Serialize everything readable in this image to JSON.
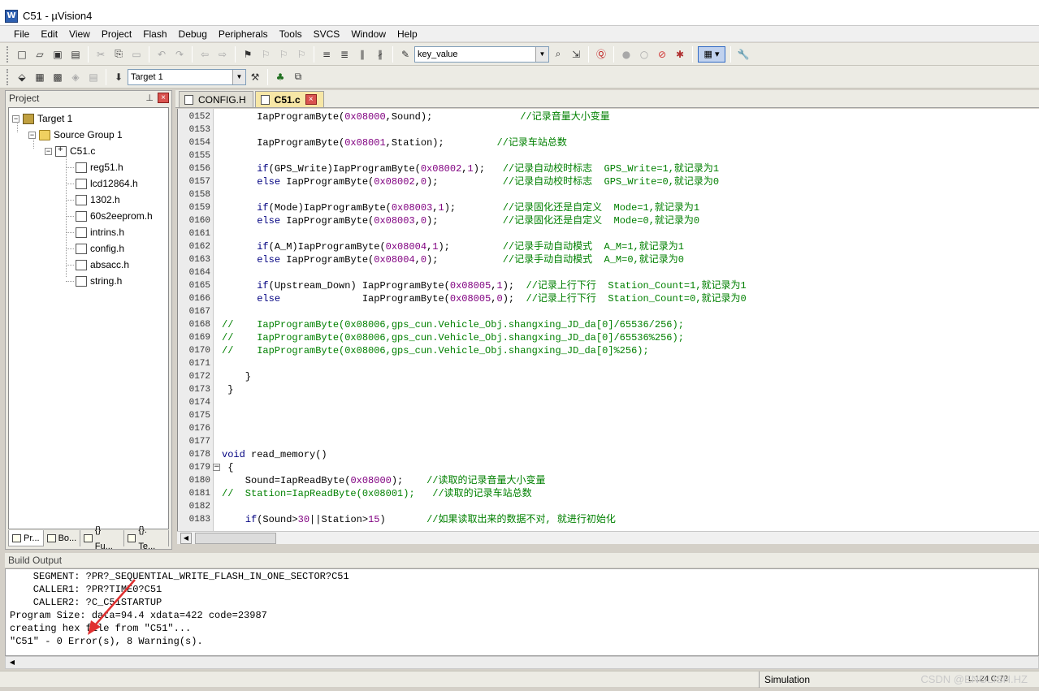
{
  "window": {
    "title": "C51  - µVision4",
    "icon_letter": "W"
  },
  "menu": [
    "File",
    "Edit",
    "View",
    "Project",
    "Flash",
    "Debug",
    "Peripherals",
    "Tools",
    "SVCS",
    "Window",
    "Help"
  ],
  "toolbar": {
    "find_value": "key_value",
    "target_value": "Target 1"
  },
  "project_panel": {
    "title": "Project",
    "tree": {
      "target": "Target 1",
      "group": "Source Group 1",
      "file": "C51.c",
      "includes": [
        "reg51.h",
        "lcd12864.h",
        "1302.h",
        "60s2eeprom.h",
        "intrins.h",
        "config.h",
        "absacc.h",
        "string.h"
      ]
    },
    "tabs": [
      "Pr...",
      "Bo...",
      "{} Fu...",
      "{}. Te..."
    ]
  },
  "editor_tabs": [
    {
      "label": "CONFIG.H",
      "active": false
    },
    {
      "label": "C51.c",
      "active": true
    }
  ],
  "code_lines": [
    {
      "n": "0152",
      "code": "      IapProgramByte(0x08000,Sound);               //记录音量大小变量"
    },
    {
      "n": "0153",
      "code": ""
    },
    {
      "n": "0154",
      "code": "      IapProgramByte(0x08001,Station);         //记录车站总数"
    },
    {
      "n": "0155",
      "code": ""
    },
    {
      "n": "0156",
      "code": "      if(GPS_Write)IapProgramByte(0x08002,1);   //记录自动校时标志  GPS_Write=1,就记录为1"
    },
    {
      "n": "0157",
      "code": "      else IapProgramByte(0x08002,0);           //记录自动校时标志  GPS_Write=0,就记录为0"
    },
    {
      "n": "0158",
      "code": ""
    },
    {
      "n": "0159",
      "code": "      if(Mode)IapProgramByte(0x08003,1);        //记录固化还是自定义  Mode=1,就记录为1"
    },
    {
      "n": "0160",
      "code": "      else IapProgramByte(0x08003,0);           //记录固化还是自定义  Mode=0,就记录为0"
    },
    {
      "n": "0161",
      "code": ""
    },
    {
      "n": "0162",
      "code": "      if(A_M)IapProgramByte(0x08004,1);         //记录手动自动模式  A_M=1,就记录为1"
    },
    {
      "n": "0163",
      "code": "      else IapProgramByte(0x08004,0);           //记录手动自动模式  A_M=0,就记录为0"
    },
    {
      "n": "0164",
      "code": ""
    },
    {
      "n": "0165",
      "code": "      if(Upstream_Down) IapProgramByte(0x08005,1);  //记录上行下行  Station_Count=1,就记录为1"
    },
    {
      "n": "0166",
      "code": "      else              IapProgramByte(0x08005,0);  //记录上行下行  Station_Count=0,就记录为0"
    },
    {
      "n": "0167",
      "code": ""
    },
    {
      "n": "0168",
      "code": "//    IapProgramByte(0x08006,gps_cun.Vehicle_Obj.shangxing_JD_da[0]/65536/256);"
    },
    {
      "n": "0169",
      "code": "//    IapProgramByte(0x08006,gps_cun.Vehicle_Obj.shangxing_JD_da[0]/65536%256);"
    },
    {
      "n": "0170",
      "code": "//    IapProgramByte(0x08006,gps_cun.Vehicle_Obj.shangxing_JD_da[0]%256);"
    },
    {
      "n": "0171",
      "code": ""
    },
    {
      "n": "0172",
      "code": "    }"
    },
    {
      "n": "0173",
      "code": " }"
    },
    {
      "n": "0174",
      "code": ""
    },
    {
      "n": "0175",
      "code": ""
    },
    {
      "n": "0176",
      "code": ""
    },
    {
      "n": "0177",
      "code": ""
    },
    {
      "n": "0178",
      "code": "void read_memory()"
    },
    {
      "n": "0179",
      "code": " {"
    },
    {
      "n": "0180",
      "code": "    Sound=IapReadByte(0x08000);    //读取的记录音量大小变量"
    },
    {
      "n": "0181",
      "code": "//  Station=IapReadByte(0x08001);   //读取的记录车站总数"
    },
    {
      "n": "0182",
      "code": ""
    },
    {
      "n": "0183",
      "code": "    if(Sound>30||Station>15)       //如果读取出来的数据不对, 就进行初始化"
    }
  ],
  "build_output": {
    "title": "Build Output",
    "lines": [
      "    SEGMENT: ?PR?_SEQUENTIAL_WRITE_FLASH_IN_ONE_SECTOR?C51",
      "    CALLER1: ?PR?TIME0?C51",
      "    CALLER2: ?C_C51STARTUP",
      "Program Size: data=94.4 xdata=422 code=23987",
      "creating hex file from \"C51\"...",
      "\"C51\" - 0 Error(s), 8 Warning(s)."
    ]
  },
  "statusbar": {
    "mode": "Simulation",
    "position": "L:124 C:72",
    "watermark": "CSDN @ENGLISH.HZ"
  },
  "colors": {
    "comment": "#008000",
    "number": "#800080",
    "annotation_arrow": "#e03030"
  }
}
